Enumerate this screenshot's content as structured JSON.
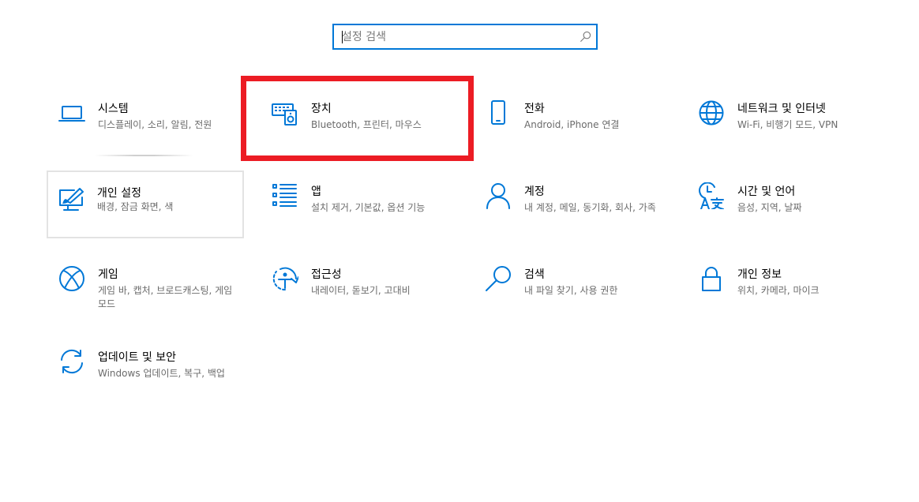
{
  "search": {
    "placeholder": "설정 검색",
    "icon": "search-icon"
  },
  "tiles": [
    {
      "title": "시스템",
      "subtitle": "디스플레이, 소리, 알림, 전원",
      "icon": "laptop-icon"
    },
    {
      "title": "장치",
      "subtitle": "Bluetooth, 프린터, 마우스",
      "icon": "devices-icon"
    },
    {
      "title": "전화",
      "subtitle": "Android, iPhone 연결",
      "icon": "phone-icon"
    },
    {
      "title": "네트워크 및 인터넷",
      "subtitle": "Wi-Fi, 비행기 모드, VPN",
      "icon": "globe-icon"
    },
    {
      "title": "개인 설정",
      "subtitle": "배경, 잠금 화면, 색",
      "icon": "personalization-icon"
    },
    {
      "title": "앱",
      "subtitle": "설치 제거, 기본값, 옵션 기능",
      "icon": "apps-list-icon"
    },
    {
      "title": "계정",
      "subtitle": "내 계정, 메일, 동기화, 회사, 가족",
      "icon": "person-icon"
    },
    {
      "title": "시간 및 언어",
      "subtitle": "음성, 지역, 날짜",
      "icon": "time-language-icon"
    },
    {
      "title": "게임",
      "subtitle": "게임 바, 캡처, 브로드캐스팅, 게임 모드",
      "icon": "xbox-icon"
    },
    {
      "title": "접근성",
      "subtitle": "내레이터, 돋보기, 고대비",
      "icon": "ease-of-access-icon"
    },
    {
      "title": "검색",
      "subtitle": "내 파일 찾기, 사용 권한",
      "icon": "search-icon"
    },
    {
      "title": "개인 정보",
      "subtitle": "위치, 카메라, 마이크",
      "icon": "lock-icon"
    },
    {
      "title": "업데이트 및 보안",
      "subtitle": "Windows 업데이트, 복구, 백업",
      "icon": "sync-icon"
    }
  ],
  "colors": {
    "accent": "#0078d7",
    "highlight": "#ec1c24",
    "subtext": "#6b6b6b"
  }
}
